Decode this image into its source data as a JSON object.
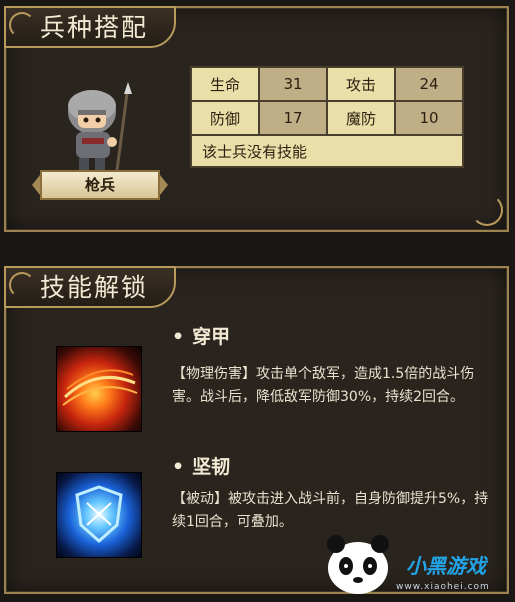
{
  "troop_panel": {
    "title": "兵种搭配",
    "unit_name": "枪兵",
    "stats": [
      {
        "label": "生命",
        "value": "31"
      },
      {
        "label": "攻击",
        "value": "24"
      },
      {
        "label": "防御",
        "value": "17"
      },
      {
        "label": "魔防",
        "value": "10"
      }
    ],
    "skill_note": "该士兵没有技能"
  },
  "skill_panel": {
    "title": "技能解锁",
    "skills": [
      {
        "bullet": "•",
        "name": "穿甲",
        "icon": "fire-slash-icon",
        "description": "【物理伤害】攻击单个敌军，造成1.5倍的战斗伤害。战斗后，降低敌军防御30%，持续2回合。"
      },
      {
        "bullet": "•",
        "name": "坚韧",
        "icon": "blue-shield-icon",
        "description": "【被动】被攻击进入战斗前，自身防御提升5%，持续1回合，可叠加。"
      }
    ]
  },
  "watermark": {
    "brand": "小黑游戏",
    "url": "www.xiaohei.com"
  },
  "colors": {
    "panel_bg": "#2a241e",
    "frame_gold": "#b89a5c",
    "table_label_bg": "#eadfa8",
    "table_value_bg": "#bfae86",
    "watermark_blue": "#22a5e8"
  }
}
